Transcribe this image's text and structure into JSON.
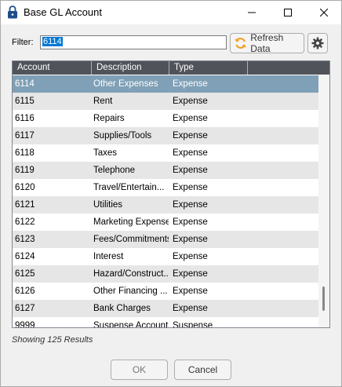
{
  "window": {
    "title": "Base GL Account"
  },
  "filter": {
    "label": "Filter:",
    "value": "6114"
  },
  "toolbar": {
    "refresh_label": "Refresh Data"
  },
  "grid": {
    "columns": [
      "Account",
      "Description",
      "Type",
      ""
    ],
    "rows": [
      {
        "account": "6114",
        "description": "Other Expenses",
        "type": "Expense"
      },
      {
        "account": "6115",
        "description": "Rent",
        "type": "Expense"
      },
      {
        "account": "6116",
        "description": "Repairs",
        "type": "Expense"
      },
      {
        "account": "6117",
        "description": "Supplies/Tools",
        "type": "Expense"
      },
      {
        "account": "6118",
        "description": "Taxes",
        "type": "Expense"
      },
      {
        "account": "6119",
        "description": "Telephone",
        "type": "Expense"
      },
      {
        "account": "6120",
        "description": "Travel/Entertain...",
        "type": "Expense"
      },
      {
        "account": "6121",
        "description": "Utilities",
        "type": "Expense"
      },
      {
        "account": "6122",
        "description": "Marketing Expense",
        "type": "Expense"
      },
      {
        "account": "6123",
        "description": "Fees/Commitments",
        "type": "Expense"
      },
      {
        "account": "6124",
        "description": "Interest",
        "type": "Expense"
      },
      {
        "account": "6125",
        "description": "Hazard/Construct...",
        "type": "Expense"
      },
      {
        "account": "6126",
        "description": "Other Financing ...",
        "type": "Expense"
      },
      {
        "account": "6127",
        "description": "Bank Charges",
        "type": "Expense"
      },
      {
        "account": "9999",
        "description": "Suspense Account",
        "type": "Suspense"
      }
    ]
  },
  "status": {
    "results_text": "Showing 125 Results"
  },
  "buttons": {
    "ok_label": "OK",
    "cancel_label": "Cancel"
  },
  "colors": {
    "header_bg": "#50535a",
    "selected_row": "#7fa0b6",
    "alt_row": "#e6e6e6",
    "refresh_icon": "#f0a020"
  }
}
